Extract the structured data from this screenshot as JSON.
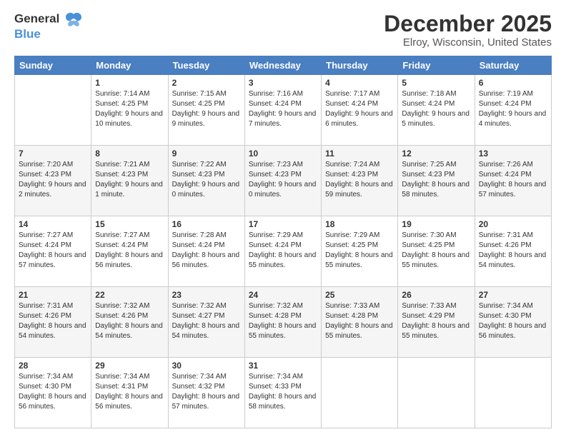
{
  "header": {
    "logo_line1": "General",
    "logo_line2": "Blue",
    "main_title": "December 2025",
    "subtitle": "Elroy, Wisconsin, United States"
  },
  "weekdays": [
    "Sunday",
    "Monday",
    "Tuesday",
    "Wednesday",
    "Thursday",
    "Friday",
    "Saturday"
  ],
  "weeks": [
    [
      {
        "day": "",
        "sunrise": "",
        "sunset": "",
        "daylight": ""
      },
      {
        "day": "1",
        "sunrise": "7:14 AM",
        "sunset": "4:25 PM",
        "daylight": "9 hours and 10 minutes."
      },
      {
        "day": "2",
        "sunrise": "7:15 AM",
        "sunset": "4:25 PM",
        "daylight": "9 hours and 9 minutes."
      },
      {
        "day": "3",
        "sunrise": "7:16 AM",
        "sunset": "4:24 PM",
        "daylight": "9 hours and 7 minutes."
      },
      {
        "day": "4",
        "sunrise": "7:17 AM",
        "sunset": "4:24 PM",
        "daylight": "9 hours and 6 minutes."
      },
      {
        "day": "5",
        "sunrise": "7:18 AM",
        "sunset": "4:24 PM",
        "daylight": "9 hours and 5 minutes."
      },
      {
        "day": "6",
        "sunrise": "7:19 AM",
        "sunset": "4:24 PM",
        "daylight": "9 hours and 4 minutes."
      }
    ],
    [
      {
        "day": "7",
        "sunrise": "7:20 AM",
        "sunset": "4:23 PM",
        "daylight": "9 hours and 2 minutes."
      },
      {
        "day": "8",
        "sunrise": "7:21 AM",
        "sunset": "4:23 PM",
        "daylight": "9 hours and 1 minute."
      },
      {
        "day": "9",
        "sunrise": "7:22 AM",
        "sunset": "4:23 PM",
        "daylight": "9 hours and 0 minutes."
      },
      {
        "day": "10",
        "sunrise": "7:23 AM",
        "sunset": "4:23 PM",
        "daylight": "9 hours and 0 minutes."
      },
      {
        "day": "11",
        "sunrise": "7:24 AM",
        "sunset": "4:23 PM",
        "daylight": "8 hours and 59 minutes."
      },
      {
        "day": "12",
        "sunrise": "7:25 AM",
        "sunset": "4:23 PM",
        "daylight": "8 hours and 58 minutes."
      },
      {
        "day": "13",
        "sunrise": "7:26 AM",
        "sunset": "4:24 PM",
        "daylight": "8 hours and 57 minutes."
      }
    ],
    [
      {
        "day": "14",
        "sunrise": "7:27 AM",
        "sunset": "4:24 PM",
        "daylight": "8 hours and 57 minutes."
      },
      {
        "day": "15",
        "sunrise": "7:27 AM",
        "sunset": "4:24 PM",
        "daylight": "8 hours and 56 minutes."
      },
      {
        "day": "16",
        "sunrise": "7:28 AM",
        "sunset": "4:24 PM",
        "daylight": "8 hours and 56 minutes."
      },
      {
        "day": "17",
        "sunrise": "7:29 AM",
        "sunset": "4:24 PM",
        "daylight": "8 hours and 55 minutes."
      },
      {
        "day": "18",
        "sunrise": "7:29 AM",
        "sunset": "4:25 PM",
        "daylight": "8 hours and 55 minutes."
      },
      {
        "day": "19",
        "sunrise": "7:30 AM",
        "sunset": "4:25 PM",
        "daylight": "8 hours and 55 minutes."
      },
      {
        "day": "20",
        "sunrise": "7:31 AM",
        "sunset": "4:26 PM",
        "daylight": "8 hours and 54 minutes."
      }
    ],
    [
      {
        "day": "21",
        "sunrise": "7:31 AM",
        "sunset": "4:26 PM",
        "daylight": "8 hours and 54 minutes."
      },
      {
        "day": "22",
        "sunrise": "7:32 AM",
        "sunset": "4:26 PM",
        "daylight": "8 hours and 54 minutes."
      },
      {
        "day": "23",
        "sunrise": "7:32 AM",
        "sunset": "4:27 PM",
        "daylight": "8 hours and 54 minutes."
      },
      {
        "day": "24",
        "sunrise": "7:32 AM",
        "sunset": "4:28 PM",
        "daylight": "8 hours and 55 minutes."
      },
      {
        "day": "25",
        "sunrise": "7:33 AM",
        "sunset": "4:28 PM",
        "daylight": "8 hours and 55 minutes."
      },
      {
        "day": "26",
        "sunrise": "7:33 AM",
        "sunset": "4:29 PM",
        "daylight": "8 hours and 55 minutes."
      },
      {
        "day": "27",
        "sunrise": "7:34 AM",
        "sunset": "4:30 PM",
        "daylight": "8 hours and 56 minutes."
      }
    ],
    [
      {
        "day": "28",
        "sunrise": "7:34 AM",
        "sunset": "4:30 PM",
        "daylight": "8 hours and 56 minutes."
      },
      {
        "day": "29",
        "sunrise": "7:34 AM",
        "sunset": "4:31 PM",
        "daylight": "8 hours and 56 minutes."
      },
      {
        "day": "30",
        "sunrise": "7:34 AM",
        "sunset": "4:32 PM",
        "daylight": "8 hours and 57 minutes."
      },
      {
        "day": "31",
        "sunrise": "7:34 AM",
        "sunset": "4:33 PM",
        "daylight": "8 hours and 58 minutes."
      },
      {
        "day": "",
        "sunrise": "",
        "sunset": "",
        "daylight": ""
      },
      {
        "day": "",
        "sunrise": "",
        "sunset": "",
        "daylight": ""
      },
      {
        "day": "",
        "sunrise": "",
        "sunset": "",
        "daylight": ""
      }
    ]
  ],
  "labels": {
    "sunrise_prefix": "Sunrise: ",
    "sunset_prefix": "Sunset: ",
    "daylight_prefix": "Daylight: "
  }
}
